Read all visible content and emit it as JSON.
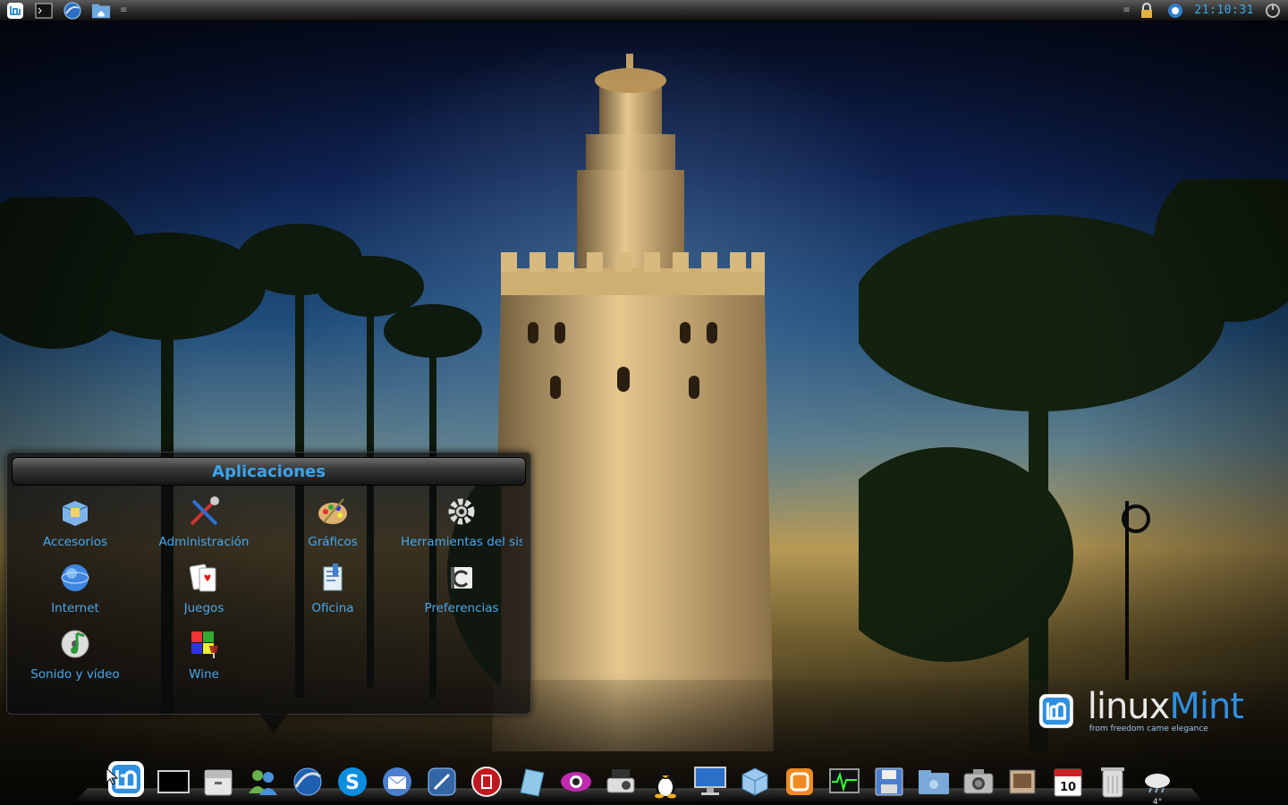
{
  "top_panel": {
    "left_icons": [
      "mint-menu-icon",
      "terminal-icon",
      "browser-icon",
      "home-folder-icon"
    ],
    "right_icons": [
      "lock-icon",
      "network-icon",
      "power-icon"
    ],
    "clock": "21:10:31"
  },
  "apps_popup": {
    "title": "Aplicaciones",
    "items": [
      {
        "label": "Accesorios",
        "icon": "accessories-icon"
      },
      {
        "label": "Administración",
        "icon": "administration-icon"
      },
      {
        "label": "Gráficos",
        "icon": "graphics-icon"
      },
      {
        "label": "Herramientas del sis",
        "icon": "system-tools-icon"
      },
      {
        "label": "Internet",
        "icon": "internet-icon"
      },
      {
        "label": "Juegos",
        "icon": "games-icon"
      },
      {
        "label": "Oficina",
        "icon": "office-icon"
      },
      {
        "label": "Preferencias",
        "icon": "preferences-icon"
      },
      {
        "label": "Sonido y vídeo",
        "icon": "sound-video-icon"
      },
      {
        "label": "Wine",
        "icon": "wine-icon"
      }
    ]
  },
  "logo": {
    "word1": "linux",
    "word2": "Mint",
    "tagline": "from freedom came elegance"
  },
  "dock": {
    "weather_temp": "4°",
    "items": [
      "mint-menu-icon",
      "terminal-icon",
      "file-cabinet-icon",
      "messenger-icon",
      "browser-icon",
      "skype-icon",
      "email-icon",
      "media-player-icon",
      "record-icon",
      "notes-icon",
      "eye-icon",
      "projector-icon",
      "tux-icon",
      "monitor-icon",
      "package-icon",
      "virtualbox-icon",
      "system-monitor-icon",
      "save-icon",
      "folder-icon",
      "camera-icon",
      "photos-icon",
      "calendar-icon",
      "trash-icon",
      "weather-icon"
    ],
    "calendar_day": "10"
  },
  "colors": {
    "accent": "#3ba4ea",
    "panel_dark": "#121212"
  }
}
